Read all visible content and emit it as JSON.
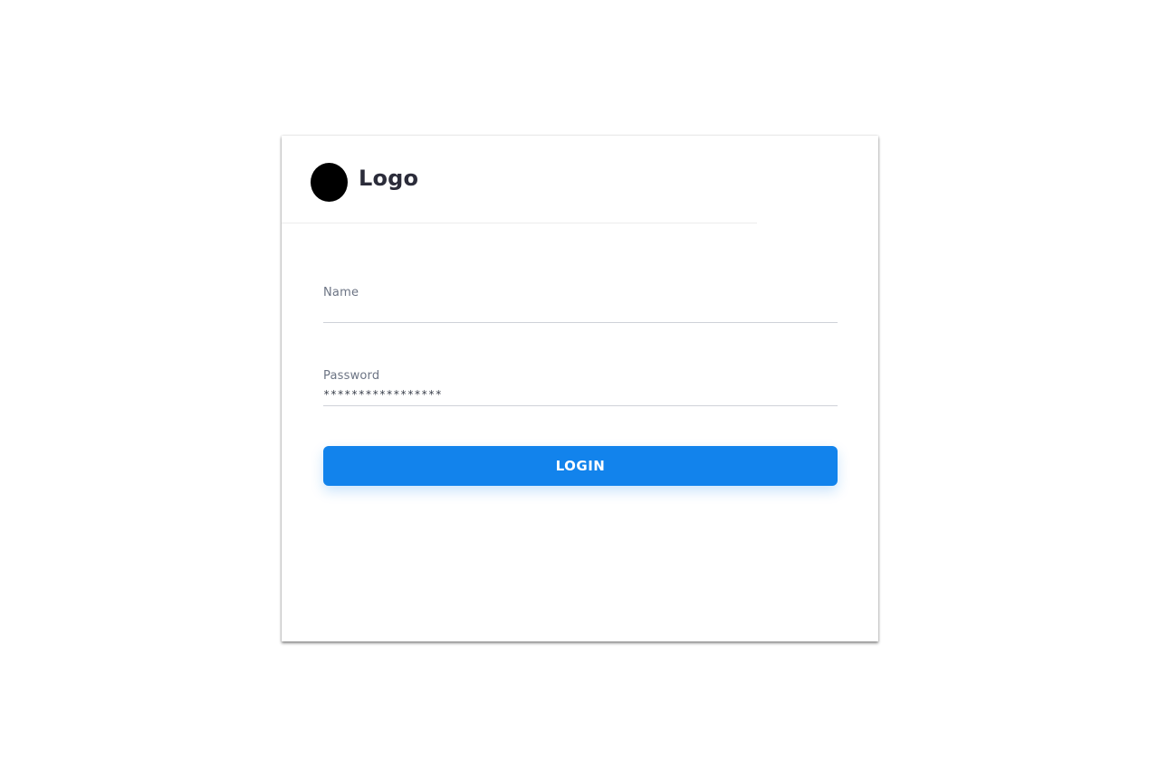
{
  "brand": {
    "logo_text": "Logo",
    "logo_mark_color": "#000000"
  },
  "form": {
    "name_label": "Name",
    "name_value": "",
    "password_label": "Password",
    "password_value": "*****************",
    "login_label": "LOGIN"
  },
  "colors": {
    "accent": "#1283ec",
    "label": "#6c7484",
    "heading": "#2b2c3a"
  }
}
